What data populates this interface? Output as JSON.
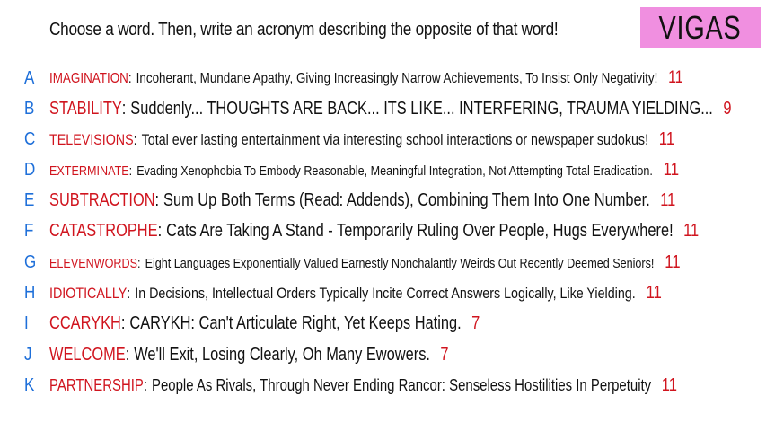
{
  "prompt": "Choose a word. Then, write an acronym describing the opposite of that word!",
  "badge": {
    "label": "VIGAS",
    "color": "#f08fe0"
  },
  "colors": {
    "letter": "#1e6fd9",
    "word": "#d0141e",
    "count": "#d0141e"
  },
  "entries": [
    {
      "letter": "A",
      "word": "IMAGINATION",
      "acronym": "Incoherant, Mundane Apathy, Giving Increasingly Narrow Achievements, To Insist Only Negativity!",
      "count": "11"
    },
    {
      "letter": "B",
      "word": "STABILITY",
      "acronym": "Suddenly... THOUGHTS ARE BACK... ITS LIKE... INTERFERING, TRAUMA YIELDING...",
      "count": "9"
    },
    {
      "letter": "C",
      "word": "TELEVISIONS",
      "acronym": "Total ever lasting entertainment via interesting school interactions or newspaper sudokus!",
      "count": "11"
    },
    {
      "letter": "D",
      "word": "EXTERMINATE",
      "acronym": "Evading Xenophobia To Embody Reasonable, Meaningful Integration, Not Attempting Total Eradication.",
      "count": "11"
    },
    {
      "letter": "E",
      "word": "SUBTRACTION",
      "acronym": "Sum Up Both Terms (Read: Addends), Combining Them Into One Number.",
      "count": "11"
    },
    {
      "letter": "F",
      "word": "CATASTROPHE",
      "acronym": "Cats Are Taking A Stand - Temporarily Ruling Over People, Hugs Everywhere!",
      "count": "11"
    },
    {
      "letter": "G",
      "word": "ELEVENWORDS",
      "acronym": "Eight Languages Exponentially Valued Earnestly Nonchalantly Weirds Out Recently Deemed Seniors!",
      "count": "11"
    },
    {
      "letter": "H",
      "word": "IDIOTICALLY",
      "acronym": "In Decisions, Intellectual Orders Typically Incite Correct Answers Logically, Like Yielding.",
      "count": "11"
    },
    {
      "letter": "I",
      "word": "CCARYKH",
      "acronym": "CARYKH: Can't Articulate Right, Yet Keeps Hating.",
      "count": "7"
    },
    {
      "letter": "J",
      "word": "WELCOME",
      "acronym": "We'll Exit, Losing Clearly, Oh Many Ewowers.",
      "count": "7"
    },
    {
      "letter": "K",
      "word": "PARTNERSHIP",
      "acronym": "People As Rivals, Through Never Ending Rancor: Senseless Hostilities In Perpetuity",
      "count": "11"
    }
  ]
}
